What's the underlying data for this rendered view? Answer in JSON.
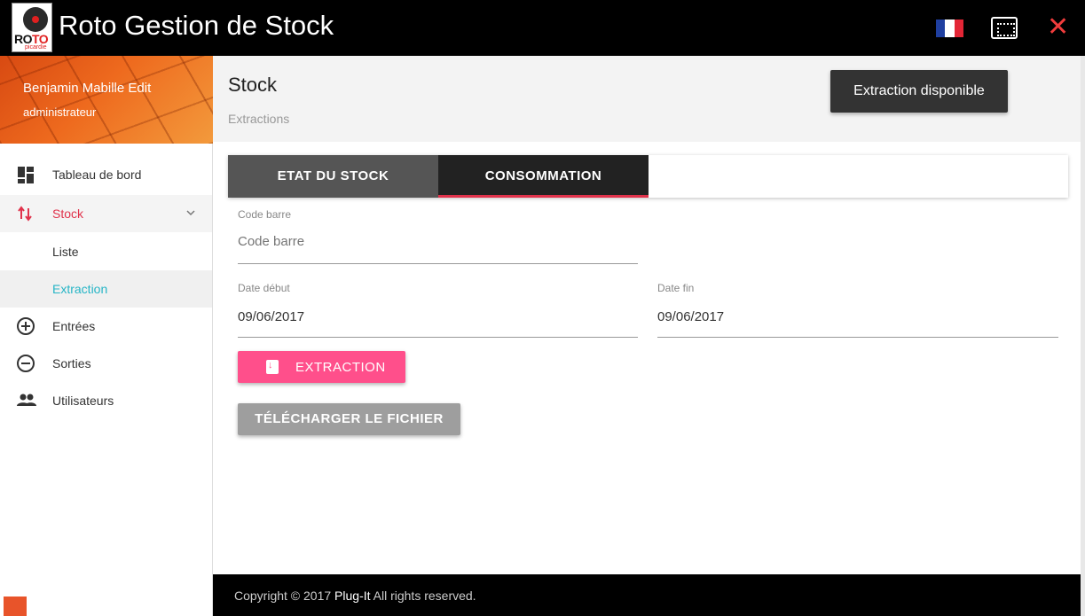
{
  "app": {
    "title": "Roto Gestion de Stock",
    "logo_text_black": "RO",
    "logo_text_red": "TO",
    "logo_sub": "picardie",
    "close_glyph": "✕",
    "colors": {
      "accent": "#e0324b",
      "pink_button": "#ff4f8b",
      "selected_sub": "#26b5c6"
    }
  },
  "user": {
    "name": "Benjamin Mabille Edit",
    "role": "administrateur"
  },
  "sidebar": {
    "items": [
      {
        "label": "Tableau de bord",
        "icon": "dashboard-icon"
      },
      {
        "label": "Stock",
        "icon": "swap-vertical-icon",
        "active": true
      },
      {
        "label": "Entrées",
        "icon": "add-circle-icon"
      },
      {
        "label": "Sorties",
        "icon": "remove-circle-icon"
      },
      {
        "label": "Utilisateurs",
        "icon": "people-icon"
      }
    ],
    "sub_items": [
      {
        "label": "Liste"
      },
      {
        "label": "Extraction",
        "selected": true
      }
    ]
  },
  "header": {
    "title": "Stock",
    "subtitle": "Extractions",
    "toast": "Extraction disponible"
  },
  "tabs": [
    {
      "label": "ETAT DU STOCK"
    },
    {
      "label": "CONSOMMATION",
      "active": true
    }
  ],
  "form": {
    "barcode": {
      "label": "Code barre",
      "placeholder": "Code barre",
      "value": ""
    },
    "date_start": {
      "label": "Date début",
      "value": "09/06/2017"
    },
    "date_end": {
      "label": "Date fin",
      "value": "09/06/2017"
    },
    "extract_button": "EXTRACTION",
    "download_button": "TÉLÉCHARGER LE FICHIER"
  },
  "footer": {
    "prefix": "Copyright © 2017 ",
    "brand": "Plug-It",
    "suffix": " All rights reserved."
  }
}
